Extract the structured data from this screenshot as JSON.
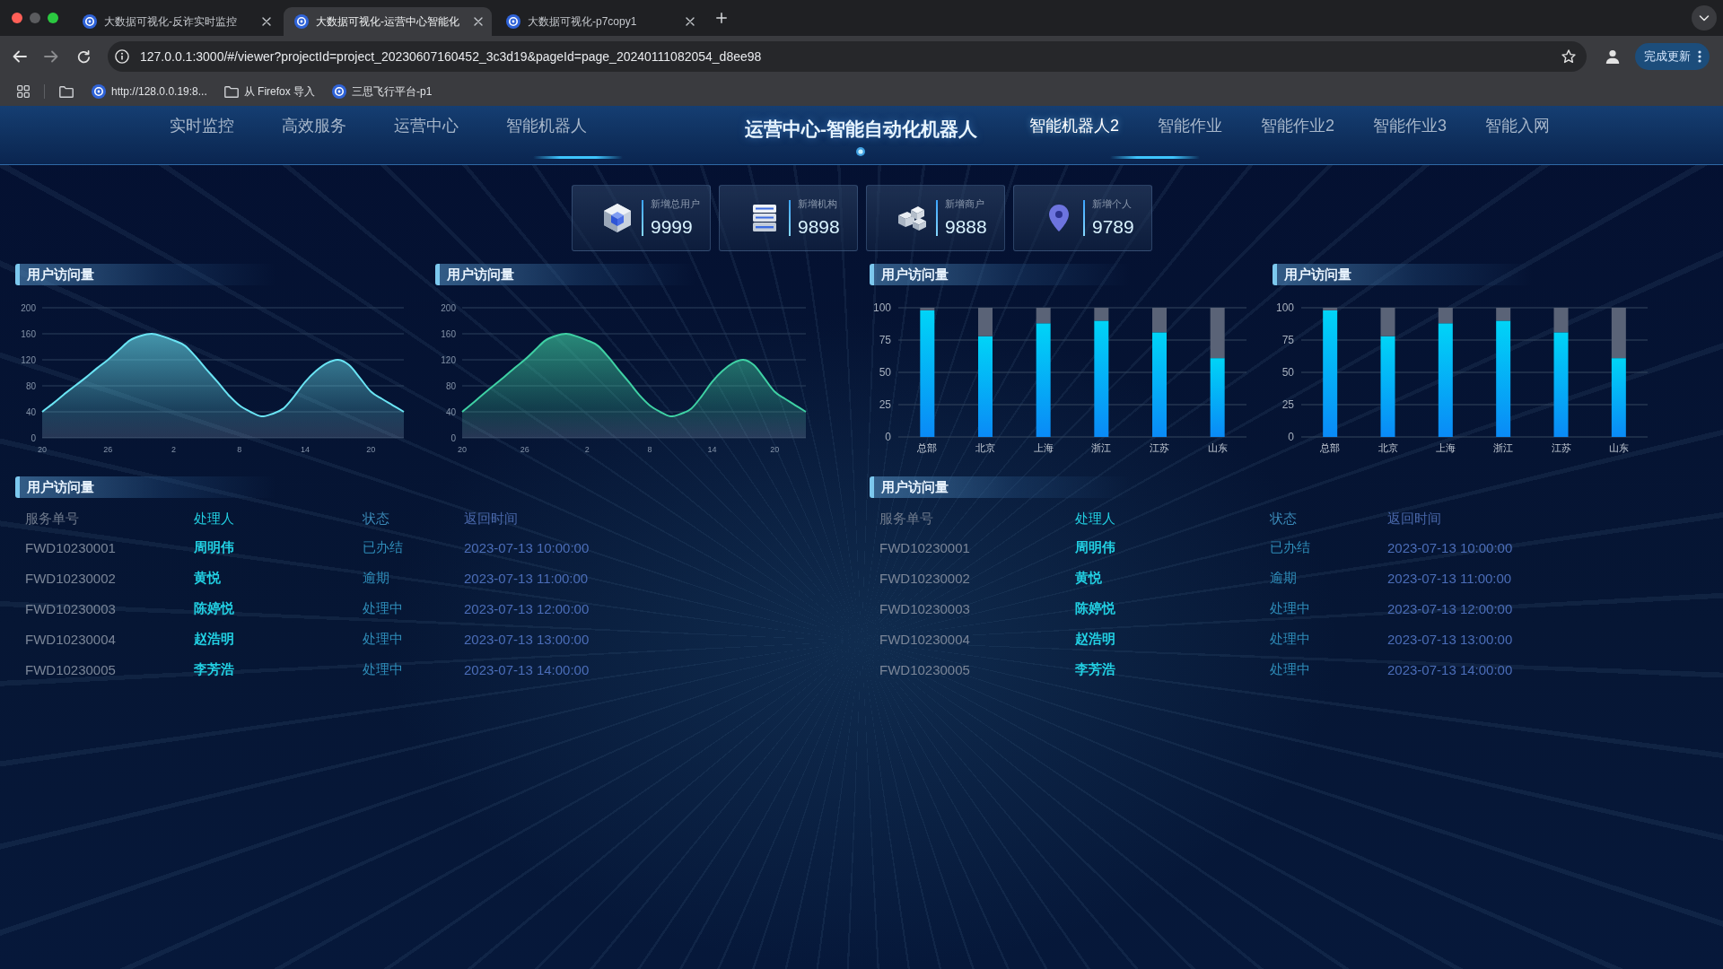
{
  "browser": {
    "tabs": [
      {
        "title": "大数据可视化-反诈实时监控",
        "selected": false
      },
      {
        "title": "大数据可视化-运营中心智能化",
        "selected": true
      },
      {
        "title": "大数据可视化-p7copy1",
        "selected": false
      }
    ],
    "url": "127.0.0.1:3000/#/viewer?projectId=project_20230607160452_3c3d19&pageId=page_20240111082054_d8ee98",
    "update_button": "完成更新",
    "bookmarks": [
      {
        "label": "http://128.0.0.19:8...",
        "kind": "site"
      },
      {
        "label": "从 Firefox 导入",
        "kind": "folder"
      },
      {
        "label": "三思飞行平台-p1",
        "kind": "site"
      }
    ]
  },
  "header": {
    "nav_left": [
      {
        "label": "实时监控",
        "selected": false
      },
      {
        "label": "高效服务",
        "selected": false
      },
      {
        "label": "运营中心",
        "selected": false
      },
      {
        "label": "智能机器人",
        "selected": false
      }
    ],
    "title": "运营中心-智能自动化机器人",
    "nav_right": [
      {
        "label": "智能机器人2",
        "selected": true
      },
      {
        "label": "智能作业",
        "selected": false
      },
      {
        "label": "智能作业2",
        "selected": false
      },
      {
        "label": "智能作业3",
        "selected": false
      },
      {
        "label": "智能入网",
        "selected": false
      }
    ]
  },
  "stats": [
    {
      "label": "新增总用户",
      "value": "9999"
    },
    {
      "label": "新增机构",
      "value": "9898"
    },
    {
      "label": "新增商户",
      "value": "9888"
    },
    {
      "label": "新增个人",
      "value": "9789"
    }
  ],
  "charts": [
    {
      "title": "用户访问量",
      "chart_data": {
        "type": "area",
        "categories": [
          "20",
          null,
          null,
          null,
          null,
          null,
          "26",
          null,
          null,
          null,
          null,
          null,
          "2",
          null,
          null,
          null,
          null,
          null,
          "8",
          null,
          null,
          null,
          null,
          null,
          "14",
          null,
          null,
          null,
          null,
          null,
          "20",
          null,
          null,
          null
        ],
        "series": [
          {
            "color": "#6ae4f4",
            "values": [
              40,
              53,
              67,
              80,
              93,
              107,
              120,
              135,
              150,
              157,
              160,
              156,
              150,
              142,
              125,
              105,
              86,
              66,
              50,
              40,
              33,
              37,
              45,
              64,
              86,
              103,
              115,
              120,
              112,
              92,
              71,
              60,
              50,
              40
            ]
          }
        ],
        "ylim": [
          0,
          200
        ],
        "yticks": [
          0,
          40,
          80,
          120,
          160,
          200
        ],
        "grid": true
      }
    },
    {
      "title": "用户访问量",
      "chart_data": {
        "type": "area",
        "categories": [
          "20",
          null,
          null,
          null,
          null,
          null,
          "26",
          null,
          null,
          null,
          null,
          null,
          "2",
          null,
          null,
          null,
          null,
          null,
          "8",
          null,
          null,
          null,
          null,
          null,
          "14",
          null,
          null,
          null,
          null,
          null,
          "20",
          null,
          null,
          null
        ],
        "series": [
          {
            "color": "#3fd1a4",
            "values": [
              40,
              53,
              67,
              80,
              93,
              107,
              120,
              135,
              150,
              157,
              160,
              156,
              150,
              142,
              125,
              105,
              86,
              66,
              50,
              40,
              33,
              37,
              45,
              64,
              86,
              103,
              115,
              120,
              112,
              92,
              71,
              60,
              50,
              40
            ]
          }
        ],
        "ylim": [
          0,
          200
        ],
        "yticks": [
          0,
          40,
          80,
          120,
          160,
          200
        ],
        "grid": true
      }
    },
    {
      "title": "用户访问量",
      "chart_data": {
        "type": "bar",
        "categories": [
          "总部",
          "北京",
          "上海",
          "浙江",
          "江苏",
          "山东"
        ],
        "series": [
          {
            "color": "#00d4f7",
            "values": [
              98,
              78,
              88,
              90,
              81,
              61
            ]
          },
          {
            "color": "#5a6377",
            "values": [
              2,
              22,
              12,
              10,
              19,
              39
            ]
          }
        ],
        "stacked": true,
        "ylim": [
          0,
          100
        ],
        "yticks": [
          0,
          25,
          50,
          75,
          100
        ],
        "grid": true
      }
    },
    {
      "title": "用户访问量",
      "chart_data": {
        "type": "bar",
        "categories": [
          "总部",
          "北京",
          "上海",
          "浙江",
          "江苏",
          "山东"
        ],
        "series": [
          {
            "color": "#00d4f7",
            "values": [
              98,
              78,
              88,
              90,
              81,
              61
            ]
          },
          {
            "color": "#5a6377",
            "values": [
              2,
              22,
              12,
              10,
              19,
              39
            ]
          }
        ],
        "stacked": true,
        "ylim": [
          0,
          100
        ],
        "yticks": [
          0,
          25,
          50,
          75,
          100
        ],
        "grid": true
      }
    }
  ],
  "tables": [
    {
      "title": "用户访问量",
      "columns": [
        "服务单号",
        "处理人",
        "状态",
        "返回时间"
      ],
      "rows": [
        [
          "FWD10230001",
          "周明伟",
          "已办结",
          "2023-07-13 10:00:00"
        ],
        [
          "FWD10230002",
          "黄悦",
          "逾期",
          "2023-07-13 11:00:00"
        ],
        [
          "FWD10230003",
          "陈婷悦",
          "处理中",
          "2023-07-13 12:00:00"
        ],
        [
          "FWD10230004",
          "赵浩明",
          "处理中",
          "2023-07-13 13:00:00"
        ],
        [
          "FWD10230005",
          "李芳浩",
          "处理中",
          "2023-07-13 14:00:00"
        ]
      ]
    },
    {
      "title": "用户访问量",
      "columns": [
        "服务单号",
        "处理人",
        "状态",
        "返回时间"
      ],
      "rows": [
        [
          "FWD10230001",
          "周明伟",
          "已办结",
          "2023-07-13 10:00:00"
        ],
        [
          "FWD10230002",
          "黄悦",
          "逾期",
          "2023-07-13 11:00:00"
        ],
        [
          "FWD10230003",
          "陈婷悦",
          "处理中",
          "2023-07-13 12:00:00"
        ],
        [
          "FWD10230004",
          "赵浩明",
          "处理中",
          "2023-07-13 13:00:00"
        ],
        [
          "FWD10230005",
          "李芳浩",
          "处理中",
          "2023-07-13 14:00:00"
        ]
      ]
    }
  ]
}
